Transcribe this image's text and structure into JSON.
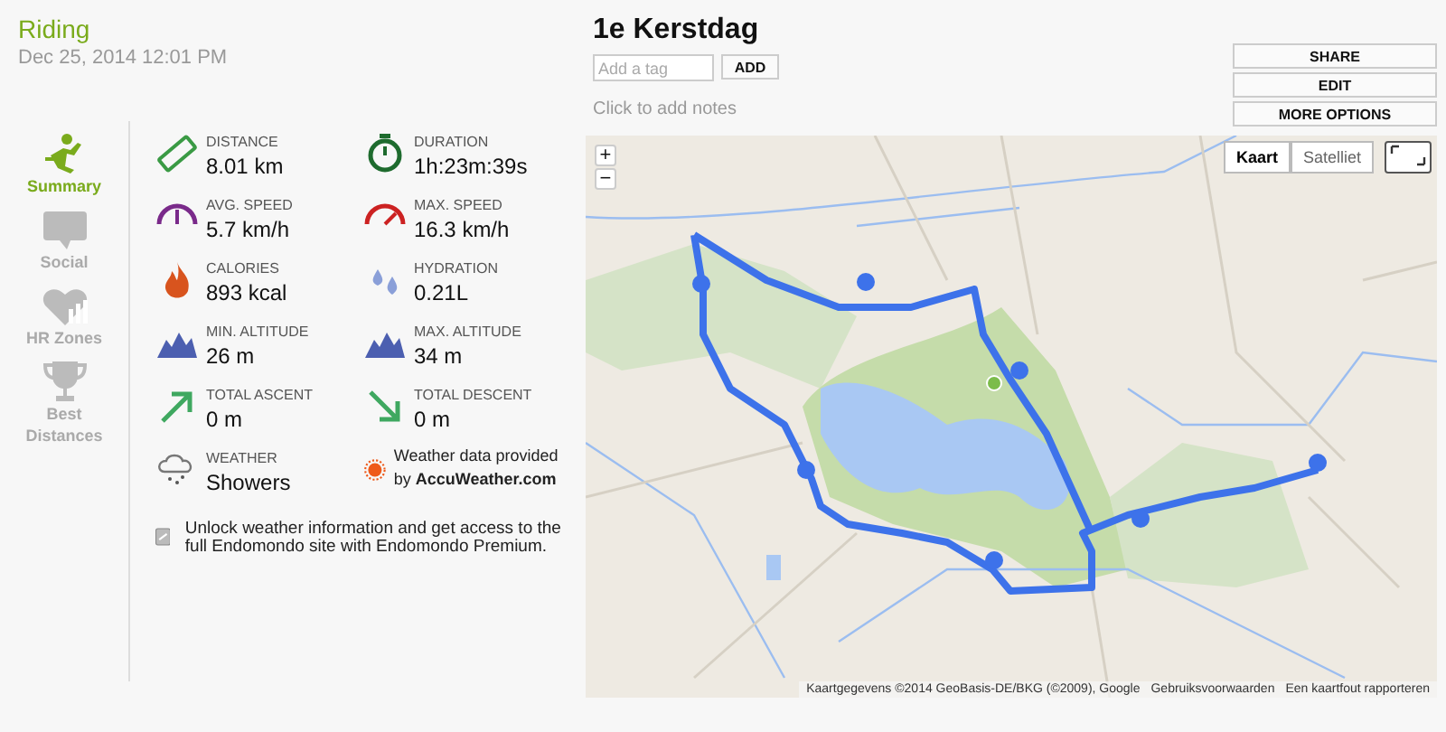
{
  "activity": {
    "sport": "Riding",
    "date": "Dec 25, 2014 12:01 PM"
  },
  "nav": [
    {
      "kind": "summary",
      "label": "Summary",
      "selected": true
    },
    {
      "kind": "social",
      "label": "Social",
      "selected": false
    },
    {
      "kind": "hr",
      "label": "HR Zones",
      "selected": false
    },
    {
      "kind": "trophy",
      "label": "Best Distances",
      "selected": false
    }
  ],
  "stats": [
    {
      "kind": "distance",
      "label": "DISTANCE",
      "value": "8.01 km"
    },
    {
      "kind": "duration",
      "label": "DURATION",
      "value": "1h:23m:39s"
    },
    {
      "kind": "avgspeed",
      "label": "AVG. SPEED",
      "value": "5.7 km/h"
    },
    {
      "kind": "maxspeed",
      "label": "MAX. SPEED",
      "value": "16.3 km/h"
    },
    {
      "kind": "calories",
      "label": "CALORIES",
      "value": "893 kcal"
    },
    {
      "kind": "hydration",
      "label": "HYDRATION",
      "value": "0.21L"
    },
    {
      "kind": "altitude",
      "label": "MIN. ALTITUDE",
      "value": "26 m"
    },
    {
      "kind": "altitude",
      "label": "MAX. ALTITUDE",
      "value": "34 m"
    },
    {
      "kind": "ascent",
      "label": "TOTAL ASCENT",
      "value": "0 m"
    },
    {
      "kind": "descent",
      "label": "TOTAL DESCENT",
      "value": "0 m"
    },
    {
      "kind": "weather",
      "label": "WEATHER",
      "value": "Showers"
    },
    {
      "kind": "provider",
      "text": "Weather data provided by **AccuWeather.com**"
    }
  ],
  "premium_notice": "Unlock weather information and get access to the full Endomondo site with Endomondo Premium.",
  "workout": {
    "title": "1e Kerstdag",
    "tag_field": {
      "placeholder": "Add a tag"
    },
    "add_button": "ADD",
    "notes_placeholder": "Click to add notes"
  },
  "actions": [
    "SHARE",
    "EDIT",
    "MORE OPTIONS"
  ],
  "map": {
    "zoom_in": "+",
    "zoom_out": "−",
    "types": [
      {
        "label": "Kaart",
        "selected": true
      },
      {
        "label": "Satelliet",
        "selected": false
      }
    ],
    "attribution": [
      "Kaartgegevens ©2014 GeoBasis-DE/BKG (©2009), Google",
      "Gebruiksvoorwaarden",
      "Een kaartfout rapporteren"
    ]
  }
}
